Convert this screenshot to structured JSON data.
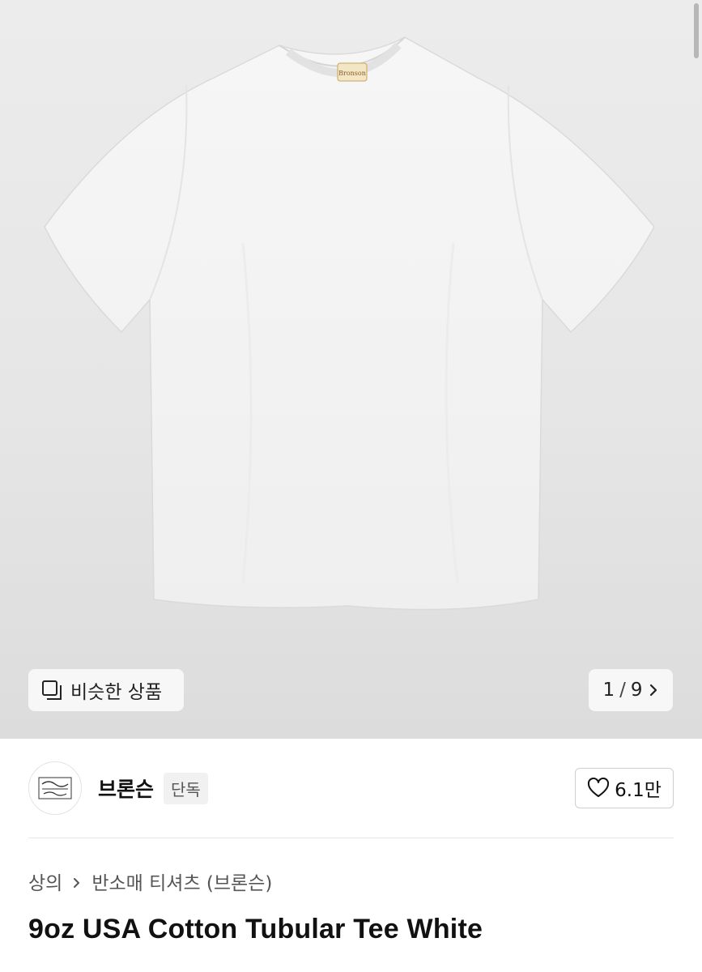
{
  "gallery": {
    "similar_label": "비슷한 상품",
    "current": "1",
    "separator": "/",
    "total": "9",
    "icons": {
      "similar": "copy-icon",
      "next": "chevron-right-icon"
    }
  },
  "brand": {
    "name": "브론슨",
    "badge": "단독",
    "logo_icon": "brand-logo-icon",
    "likes": "6.1만",
    "like_icon": "heart-icon"
  },
  "breadcrumb": {
    "items": [
      "상의",
      "반소매 티셔츠 (브론슨)"
    ]
  },
  "product": {
    "title": "9oz USA Cotton Tubular Tee White"
  }
}
